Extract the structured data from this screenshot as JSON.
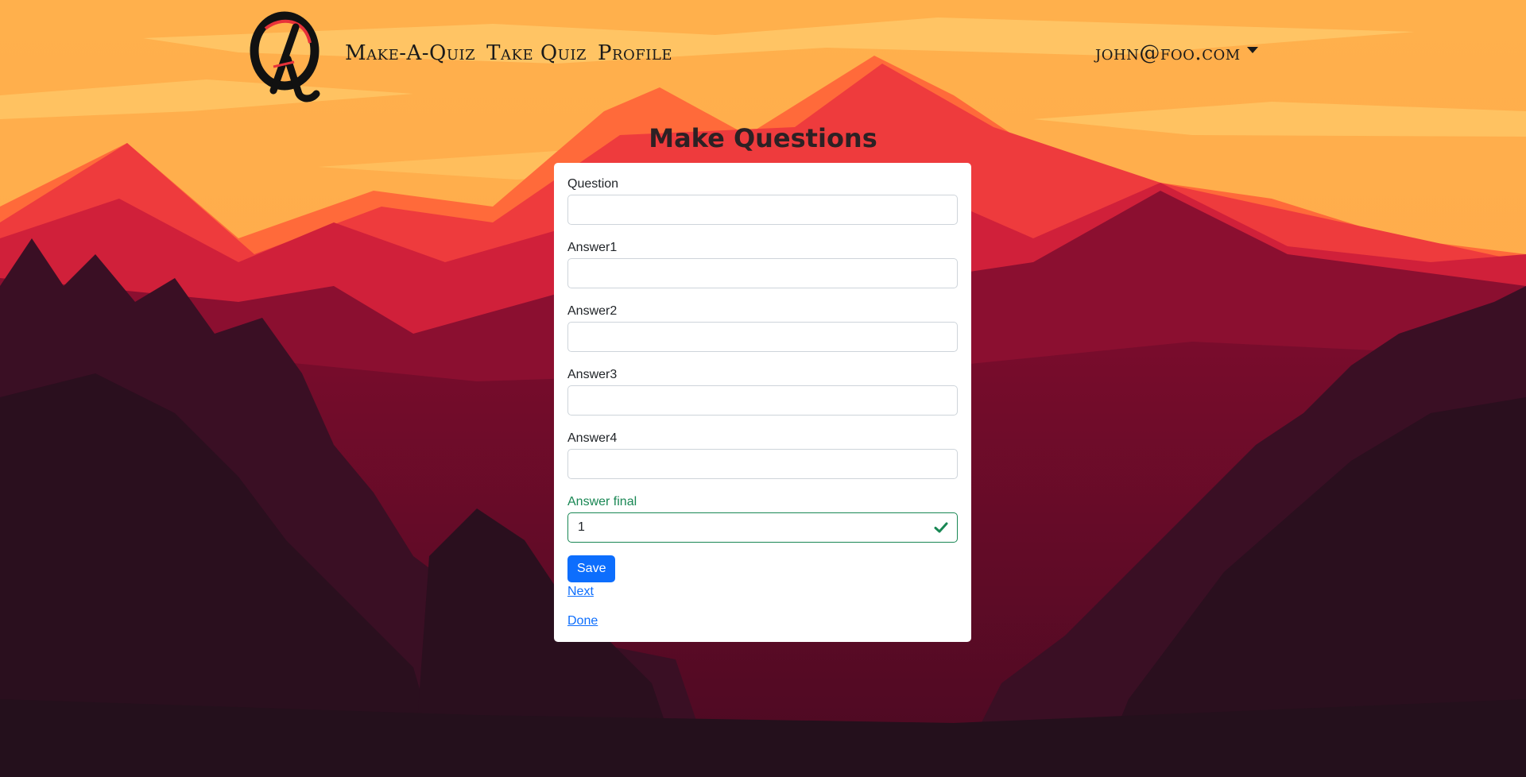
{
  "nav": {
    "brand": "logo",
    "links": [
      "Make-A-Quiz",
      "Take Quiz",
      "Profile"
    ],
    "user_email": "john@foo.com"
  },
  "page": {
    "title": "Make Questions"
  },
  "form": {
    "fields": [
      {
        "label": "Question",
        "value": ""
      },
      {
        "label": "Answer1",
        "value": ""
      },
      {
        "label": "Answer2",
        "value": ""
      },
      {
        "label": "Answer3",
        "value": ""
      },
      {
        "label": "Answer4",
        "value": ""
      }
    ],
    "final": {
      "label": "Answer final",
      "value": "1"
    },
    "save_label": "Save",
    "next_label": "Next",
    "done_label": "Done"
  },
  "colors": {
    "primary": "#0d6efd",
    "valid": "#198754",
    "sky": "#ffab4a",
    "mountain": "#e8323a",
    "forest": "#2a0f1e"
  },
  "icons": {
    "logo": "quiz-q-logo-icon",
    "dropdown": "caret-down-icon",
    "valid": "check-icon"
  }
}
